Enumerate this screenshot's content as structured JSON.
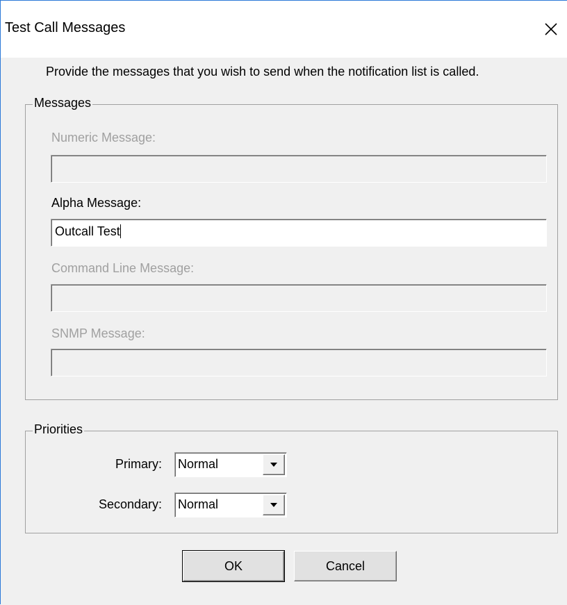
{
  "window": {
    "title": "Test Call Messages",
    "close_icon": "close-icon"
  },
  "intro": "Provide the messages that you wish to send when the notification list is called.",
  "messages": {
    "legend": "Messages",
    "numeric": {
      "label": "Numeric Message:",
      "value": "",
      "enabled": false
    },
    "alpha": {
      "label": "Alpha Message:",
      "value": "Outcall Test",
      "enabled": true
    },
    "command_line": {
      "label": "Command Line Message:",
      "value": "",
      "enabled": false
    },
    "snmp": {
      "label": "SNMP Message:",
      "value": "",
      "enabled": false
    }
  },
  "priorities": {
    "legend": "Priorities",
    "primary": {
      "label": "Primary:",
      "value": "Normal",
      "icon": "chevron-down-icon"
    },
    "secondary": {
      "label": "Secondary:",
      "value": "Normal",
      "icon": "chevron-down-icon"
    }
  },
  "buttons": {
    "ok": "OK",
    "cancel": "Cancel"
  },
  "colors": {
    "window_border": "#2b79d8",
    "dialog_background": "#f0f0f0",
    "disabled_text": "#a0a0a0"
  }
}
